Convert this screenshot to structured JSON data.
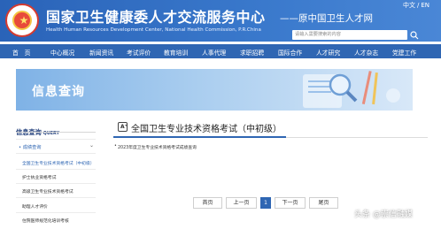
{
  "header": {
    "title_cn": "国家卫生健康委人才交流服务中心",
    "title_en": "Health Human Resources Development Center, National Health Commission, P.R.China",
    "former_name": "——原中国卫生人才网",
    "lang_cn": "中文",
    "lang_sep": "/",
    "lang_en": "EN",
    "search_placeholder": "请输入需要搜索的内容",
    "logo_icon": "emblem-logo",
    "search_icon": "search-icon"
  },
  "nav": {
    "items": [
      "首　页",
      "中心概况",
      "新闻资讯",
      "考试评价",
      "教育培训",
      "人事代理",
      "求职招聘",
      "国际合作",
      "人才研究",
      "人才杂志",
      "党建工作"
    ]
  },
  "banner": {
    "title": "信息查询"
  },
  "sidebar": {
    "heading_cn": "信息查询",
    "heading_en": "QUERY",
    "group_label": "成绩查询",
    "items": [
      "全国卫生专业技术资格考试（中初级）",
      "护士执业资格考试",
      "高级卫生专业技术资格考试",
      "助理人才评价",
      "住院医师规范化培训考核"
    ]
  },
  "main": {
    "title": "全国卫生专业技术资格考试（中初级）",
    "items": [
      "2023年度卫生专业技术资格考试成绩查询"
    ]
  },
  "pagination": {
    "first": "首页",
    "prev": "上一页",
    "current": "1",
    "next": "下一页",
    "last": "尾页"
  },
  "watermark": {
    "text": "头条 @崇信融媒"
  },
  "colors": {
    "header_bg": "#2f66b3",
    "accent": "#2f66b3",
    "logo_red": "#d63a2f"
  }
}
